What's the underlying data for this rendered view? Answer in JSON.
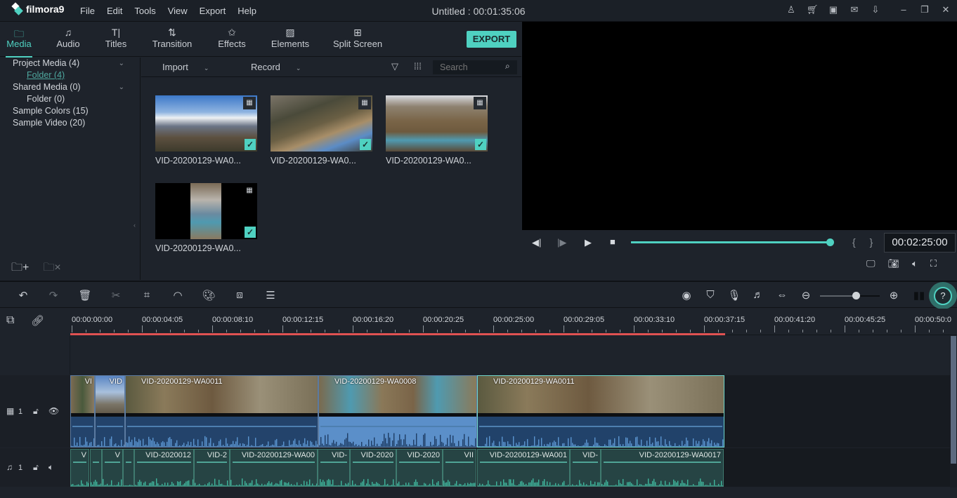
{
  "app": {
    "brand": "filmora9",
    "menu": [
      "File",
      "Edit",
      "Tools",
      "View",
      "Export",
      "Help"
    ],
    "title": "Untitled : 00:01:35:06",
    "window_icons": [
      "account-icon",
      "cart-icon",
      "save-icon",
      "mail-icon",
      "download-icon",
      "minimize-icon",
      "restore-icon",
      "close-icon"
    ]
  },
  "tabs": [
    {
      "label": "Media",
      "icon": "folder-icon",
      "active": true
    },
    {
      "label": "Audio",
      "icon": "music-note-icon"
    },
    {
      "label": "Titles",
      "icon": "text-icon"
    },
    {
      "label": "Transition",
      "icon": "transition-icon"
    },
    {
      "label": "Effects",
      "icon": "effects-icon"
    },
    {
      "label": "Elements",
      "icon": "image-icon"
    },
    {
      "label": "Split Screen",
      "icon": "split-screen-icon"
    }
  ],
  "export_label": "EXPORT",
  "library": {
    "items": [
      {
        "label": "Project Media (4)",
        "level": 0,
        "expandable": true
      },
      {
        "label": "Folder (4)",
        "level": 1,
        "selected": true
      },
      {
        "label": "Shared Media (0)",
        "level": 0,
        "expandable": true
      },
      {
        "label": "Folder (0)",
        "level": 1
      },
      {
        "label": "Sample Colors (15)",
        "level": 0
      },
      {
        "label": "Sample Video (20)",
        "level": 0
      }
    ]
  },
  "media_toolbar": {
    "import_label": "Import",
    "record_label": "Record",
    "search_placeholder": "Search"
  },
  "media_items": [
    {
      "name": "VID-20200129-WA0...",
      "checked": true
    },
    {
      "name": "VID-20200129-WA0...",
      "checked": true
    },
    {
      "name": "VID-20200129-WA0...",
      "checked": true
    },
    {
      "name": "VID-20200129-WA0...",
      "checked": true
    }
  ],
  "player": {
    "timecode": "00:02:25:00",
    "progress_percent": 100,
    "brackets": "{ }"
  },
  "timeline": {
    "ruler_labels": [
      "00:00:00:00",
      "00:00:04:05",
      "00:00:08:10",
      "00:00:12:15",
      "00:00:16:20",
      "00:00:20:25",
      "00:00:25:00",
      "00:00:29:05",
      "00:00:33:10",
      "00:00:37:15",
      "00:00:41:20",
      "00:00:45:25",
      "00:00:50:0"
    ],
    "zoom_level_percent": 60,
    "video_track": {
      "label": "1",
      "clips": [
        {
          "label": "VI"
        },
        {
          "label": "VID"
        },
        {
          "label": "VID-20200129-WA0011"
        },
        {
          "label": "VID-20200129-WA0008"
        },
        {
          "label": "VID-20200129-WA0011"
        }
      ]
    },
    "audio_track": {
      "label": "1",
      "clips": [
        {
          "label": "V"
        },
        {
          "label": ""
        },
        {
          "label": "V"
        },
        {
          "label": ""
        },
        {
          "label": "VID-2020012"
        },
        {
          "label": "VID-2"
        },
        {
          "label": "VID-20200129-WA00"
        },
        {
          "label": "VID-"
        },
        {
          "label": "VID-2020"
        },
        {
          "label": "VID-2020"
        },
        {
          "label": "VII"
        },
        {
          "label": "VID-20200129-WA001"
        },
        {
          "label": "VID-"
        },
        {
          "label": "VID-20200129-WA0017"
        }
      ]
    }
  }
}
